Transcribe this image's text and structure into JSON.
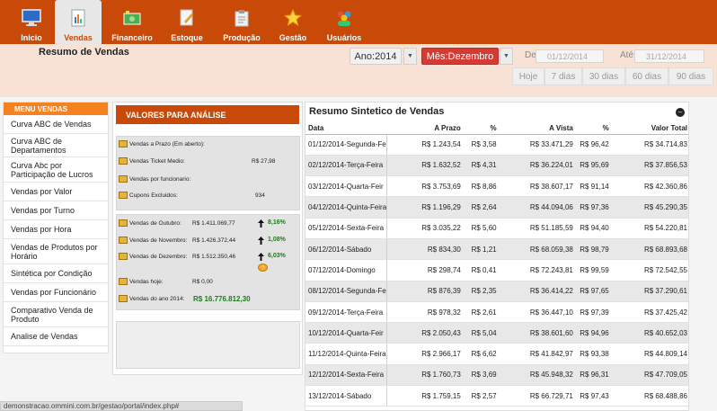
{
  "nav": {
    "items": [
      {
        "label": "Inicio",
        "icon": "monitor-icon",
        "active": false
      },
      {
        "label": "Vendas",
        "icon": "sales-report-icon",
        "active": true
      },
      {
        "label": "Financeiro",
        "icon": "money-icon",
        "active": false
      },
      {
        "label": "Estoque",
        "icon": "document-edit-icon",
        "active": false
      },
      {
        "label": "Produção",
        "icon": "clipboard-icon",
        "active": false
      },
      {
        "label": "Gestão",
        "icon": "star-icon",
        "active": false
      },
      {
        "label": "Usuários",
        "icon": "users-icon",
        "active": false
      }
    ]
  },
  "header": {
    "title": "Resumo de Vendas",
    "year_select": "Ano:2014",
    "month_select": "Mês:Dezembro",
    "from_label": "De",
    "from_value": "01/12/2014",
    "to_label": "Até",
    "to_value": "31/12/2014",
    "ranges": [
      "Hoje",
      "7 dias",
      "30 dias",
      "60 dias",
      "90 dias"
    ]
  },
  "menu": {
    "title": "MENU VENDAS",
    "items": [
      "Curva ABC de Vendas",
      "Curva ABC de Departamentos",
      "Curva Abc por Participação de Lucros",
      "Vendas por Valor",
      "Vendas por Turno",
      "Vendas por Hora",
      "Vendas de Produtos por Horário",
      "Sintética por Condição",
      "Vendas por Funcionário",
      "Comparativo Venda de Produto",
      "Analise de Vendas"
    ]
  },
  "analysis": {
    "title": "VALORES PARA ANÁLISE",
    "box1": {
      "prazo_label": "Vendas a Prazo (Em aberto):",
      "ticket_label": "Vendas Ticket Medio:",
      "ticket_value": "R$ 27,98",
      "func_label": "Vendas por funcionario:",
      "cupons_label": "Cupons Excluidos:",
      "cupons_value": "934"
    },
    "box2": {
      "out_label": "Vendas de Outubro:",
      "out_value": "R$ 1.411.069,77",
      "out_pct": "8,16%",
      "nov_label": "Vendas de Novembro:",
      "nov_value": "R$ 1.426.372,44",
      "nov_pct": "1,08%",
      "dez_label": "Vendas de Dezembro:",
      "dez_value": "R$ 1.512.350,46",
      "dez_pct": "6,03%",
      "hoje_label": "Vendas hoje:",
      "hoje_value": "R$ 0,00",
      "ano_label": "Vendas do ano 2014:",
      "ano_value": "R$ 16.776.812,30"
    }
  },
  "summary": {
    "title": "Resumo Sintetico de Vendas",
    "columns": [
      "Data",
      "A Prazo",
      "%",
      "A Vista",
      "%",
      "Valor Total"
    ],
    "rows": [
      [
        "01/12/2014-Segunda-Fe",
        "R$ 1.243,54",
        "R$ 3,58",
        "R$ 33.471,29",
        "R$ 96,42",
        "R$ 34.714,83"
      ],
      [
        "02/12/2014-Terça-Feira",
        "R$ 1.632,52",
        "R$ 4,31",
        "R$ 36.224,01",
        "R$ 95,69",
        "R$ 37.856,53"
      ],
      [
        "03/12/2014-Quarta-Feir",
        "R$ 3.753,69",
        "R$ 8,86",
        "R$ 38.607,17",
        "R$ 91,14",
        "R$ 42.360,86"
      ],
      [
        "04/12/2014-Quinta-Feira",
        "R$ 1.196,29",
        "R$ 2,64",
        "R$ 44.094,06",
        "R$ 97,36",
        "R$ 45.290,35"
      ],
      [
        "05/12/2014-Sexta-Feira",
        "R$ 3.035,22",
        "R$ 5,60",
        "R$ 51.185,59",
        "R$ 94,40",
        "R$ 54.220,81"
      ],
      [
        "06/12/2014-Sábado",
        "R$ 834,30",
        "R$ 1,21",
        "R$ 68.059,38",
        "R$ 98,79",
        "R$ 68.893,68"
      ],
      [
        "07/12/2014-Domingo",
        "R$ 298,74",
        "R$ 0,41",
        "R$ 72.243,81",
        "R$ 99,59",
        "R$ 72.542,55"
      ],
      [
        "08/12/2014-Segunda-Fe",
        "R$ 876,39",
        "R$ 2,35",
        "R$ 36.414,22",
        "R$ 97,65",
        "R$ 37.290,61"
      ],
      [
        "09/12/2014-Terça-Feira",
        "R$ 978,32",
        "R$ 2,61",
        "R$ 36.447,10",
        "R$ 97,39",
        "R$ 37.425,42"
      ],
      [
        "10/12/2014-Quarta-Feir",
        "R$ 2.050,43",
        "R$ 5,04",
        "R$ 38.601,60",
        "R$ 94,96",
        "R$ 40.652,03"
      ],
      [
        "11/12/2014-Quinta-Feira",
        "R$ 2.966,17",
        "R$ 6,62",
        "R$ 41.842,97",
        "R$ 93,38",
        "R$ 44.809,14"
      ],
      [
        "12/12/2014-Sexta-Feira",
        "R$ 1.760,73",
        "R$ 3,69",
        "R$ 45.948,32",
        "R$ 96,31",
        "R$ 47.709,05"
      ],
      [
        "13/12/2014-Sábado",
        "R$ 1.759,15",
        "R$ 2,57",
        "R$ 66.729,71",
        "R$ 97,43",
        "R$ 68.488,86"
      ]
    ]
  },
  "status": {
    "url": "demonstracao.ommini.com.br/gestao/portal/index.php#"
  },
  "colors": {
    "brand": "#c94a08",
    "accent_orange": "#f58220",
    "red_button": "#d53a33",
    "positive": "#1e7d1e"
  }
}
